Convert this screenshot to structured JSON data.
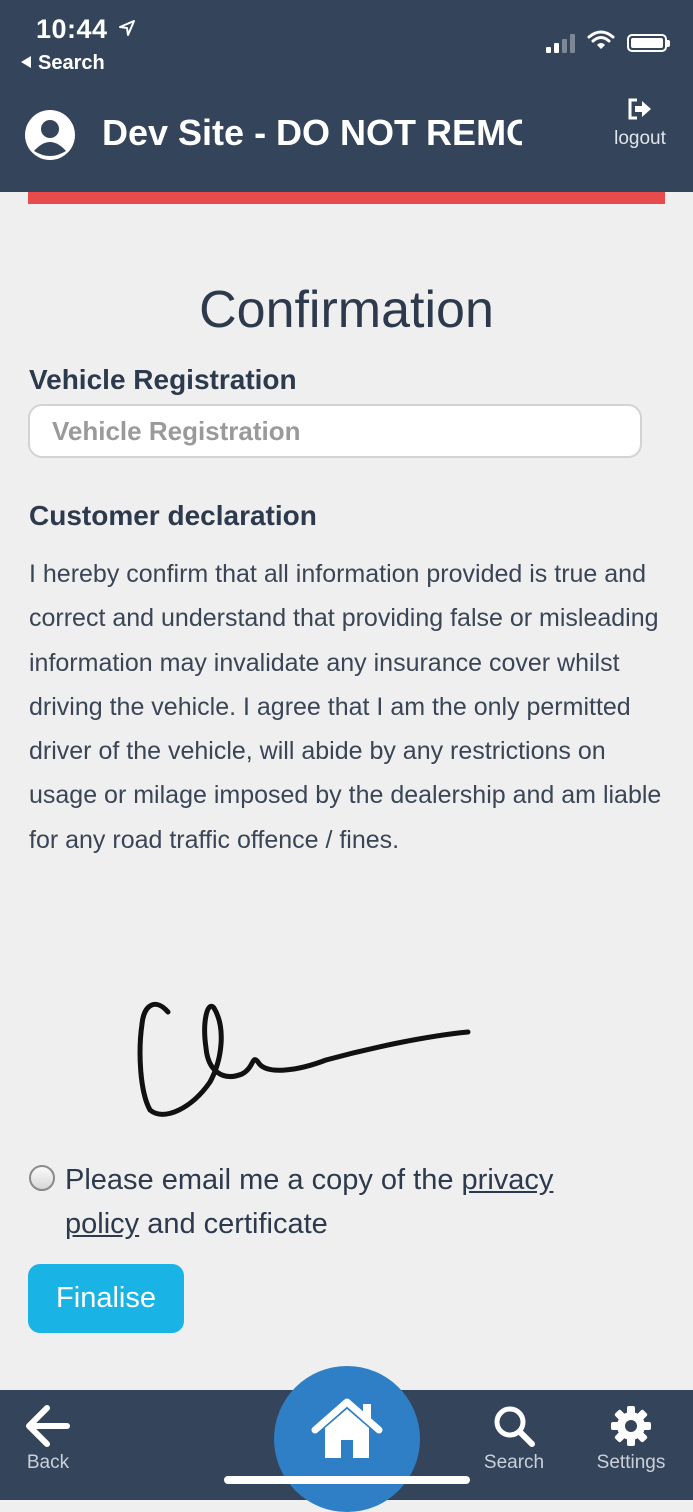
{
  "status_bar": {
    "time": "10:44",
    "back_label": "Search"
  },
  "header": {
    "title": "Dev Site - DO NOT REMOVE",
    "logout_label": "logout",
    "accent_color": "#e74b4b"
  },
  "page": {
    "heading": "Confirmation"
  },
  "vehicle_registration": {
    "label": "Vehicle Registration",
    "placeholder": "Vehicle Registration",
    "value": ""
  },
  "declaration": {
    "heading": "Customer declaration",
    "text": "I hereby confirm that all information provided is true and correct and understand that providing false or misleading information may invalidate any insurance cover whilst driving the vehicle. I agree that I am the only permitted driver of the vehicle, will abide by any restrictions on usage or milage imposed by the dealership and am liable for any road traffic offence / fines."
  },
  "email_option": {
    "selected": false,
    "text_before": "Please email me a copy of the ",
    "link_text": "privacy policy",
    "text_after": " and certificate"
  },
  "finalise_button": {
    "label": "Finalise",
    "color": "#19b3e6"
  },
  "bottom_nav": {
    "back_label": "Back",
    "search_label": "Search",
    "settings_label": "Settings",
    "home_icon": "home-icon",
    "home_color": "#2e7fc6"
  }
}
